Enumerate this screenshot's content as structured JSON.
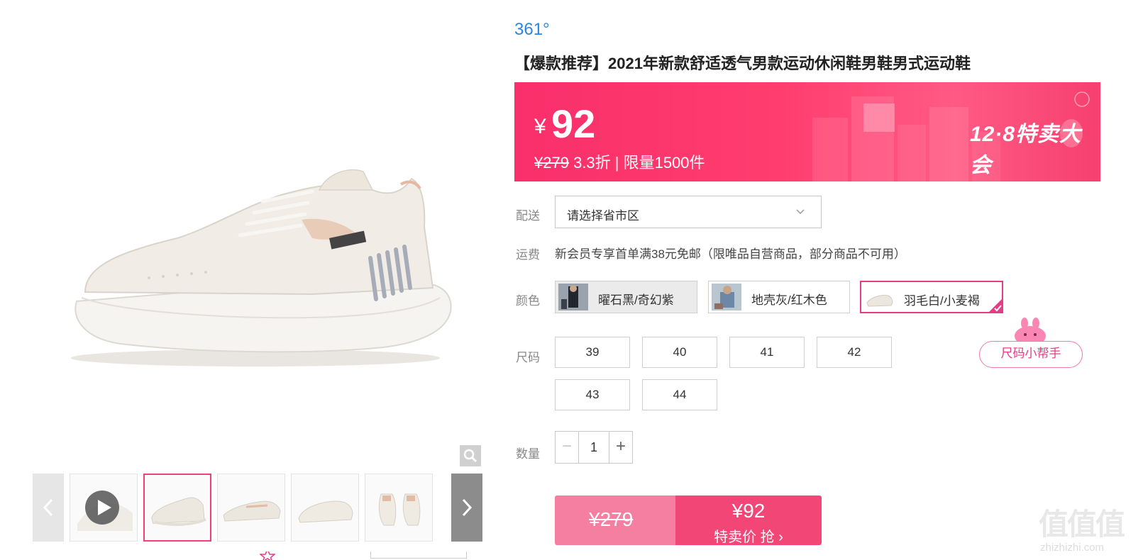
{
  "product": {
    "brand": "361°",
    "title": "【爆款推荐】2021年新款舒适透气男款运动休闲鞋男鞋男式运动鞋"
  },
  "price_banner": {
    "currency": "¥",
    "price": "92",
    "original_price": "¥279",
    "discount_info": "3.3折 | 限量1500件",
    "promo_label": "12·8特卖大会",
    "colors": {
      "accent": "#ff3d6e",
      "text": "#ffffff"
    }
  },
  "delivery": {
    "label": "配送",
    "placeholder": "请选择省市区"
  },
  "shipping": {
    "label": "运费",
    "text": "新会员专享首单满38元免邮（限唯品自营商品，部分商品不可用）"
  },
  "color": {
    "label": "颜色",
    "options": [
      {
        "name": "曜石黑/奇幻紫",
        "state": "disabled"
      },
      {
        "name": "地壳灰/红木色",
        "state": "normal"
      },
      {
        "name": "羽毛白/小麦褐",
        "state": "selected"
      }
    ]
  },
  "size": {
    "label": "尺码",
    "options": [
      "39",
      "40",
      "41",
      "42",
      "43",
      "44"
    ],
    "helper": "尺码小帮手"
  },
  "quantity": {
    "label": "数量",
    "value": "1",
    "minus": "−",
    "plus": "+"
  },
  "buy": {
    "original": "¥279",
    "price": "¥92",
    "cta": "特卖价 抢 ›"
  },
  "gallery": {
    "thumb_count": 5,
    "active_index": 1
  },
  "watermark": {
    "logo_text": "值值值",
    "domain": "zhizhizhi.com"
  }
}
